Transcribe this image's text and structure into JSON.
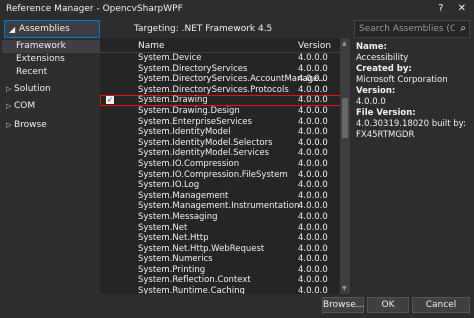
{
  "window": {
    "title": "Reference Manager - OpencvSharpWPF",
    "help_btn": "?",
    "close_btn": "✕"
  },
  "header": {
    "assemblies_label": "Assemblies",
    "targeting_text": "Targeting: .NET Framework 4.5",
    "search_placeholder": "Search Assemblies (Ctrl+E"
  },
  "sidebar": {
    "items": [
      {
        "label": "Framework"
      },
      {
        "label": "Extensions"
      },
      {
        "label": "Recent"
      },
      {
        "label": "Solution"
      },
      {
        "label": "COM"
      },
      {
        "label": "Browse"
      }
    ]
  },
  "list": {
    "col_name": "Name",
    "col_version": "Version",
    "rows": [
      {
        "name": "System.Device",
        "version": "4.0.0.0",
        "checked": false
      },
      {
        "name": "System.DirectoryServices",
        "version": "4.0.0.0",
        "checked": false
      },
      {
        "name": "System.DirectoryServices.AccountManage...",
        "version": "4.0.0.0",
        "checked": false
      },
      {
        "name": "System.DirectoryServices.Protocols",
        "version": "4.0.0.0",
        "checked": false
      },
      {
        "name": "System.Drawing",
        "version": "4.0.0.0",
        "checked": true
      },
      {
        "name": "System.Drawing.Design",
        "version": "4.0.0.0",
        "checked": false
      },
      {
        "name": "System.EnterpriseServices",
        "version": "4.0.0.0",
        "checked": false
      },
      {
        "name": "System.IdentityModel",
        "version": "4.0.0.0",
        "checked": false
      },
      {
        "name": "System.IdentityModel.Selectors",
        "version": "4.0.0.0",
        "checked": false
      },
      {
        "name": "System.IdentityModel.Services",
        "version": "4.0.0.0",
        "checked": false
      },
      {
        "name": "System.IO.Compression",
        "version": "4.0.0.0",
        "checked": false
      },
      {
        "name": "System.IO.Compression.FileSystem",
        "version": "4.0.0.0",
        "checked": false
      },
      {
        "name": "System.IO.Log",
        "version": "4.0.0.0",
        "checked": false
      },
      {
        "name": "System.Management",
        "version": "4.0.0.0",
        "checked": false
      },
      {
        "name": "System.Management.Instrumentation",
        "version": "4.0.0.0",
        "checked": false
      },
      {
        "name": "System.Messaging",
        "version": "4.0.0.0",
        "checked": false
      },
      {
        "name": "System.Net",
        "version": "4.0.0.0",
        "checked": false
      },
      {
        "name": "System.Net.Http",
        "version": "4.0.0.0",
        "checked": false
      },
      {
        "name": "System.Net.Http.WebRequest",
        "version": "4.0.0.0",
        "checked": false
      },
      {
        "name": "System.Numerics",
        "version": "4.0.0.0",
        "checked": false
      },
      {
        "name": "System.Printing",
        "version": "4.0.0.0",
        "checked": false
      },
      {
        "name": "System.Reflection.Context",
        "version": "4.0.0.0",
        "checked": false
      },
      {
        "name": "System.Runtime.Caching",
        "version": "4.0.0.0",
        "checked": false
      }
    ]
  },
  "details": {
    "name_label": "Name:",
    "name_value": "Accessibility",
    "created_label": "Created by:",
    "created_value": "Microsoft Corporation",
    "version_label": "Version:",
    "version_value": "4.0.0.0",
    "filever_label": "File Version:",
    "filever_value": "4.0.30319.18020 built by: FX45RTMGDR"
  },
  "buttons": {
    "browse": "Browse...",
    "ok": "OK",
    "cancel": "Cancel"
  }
}
